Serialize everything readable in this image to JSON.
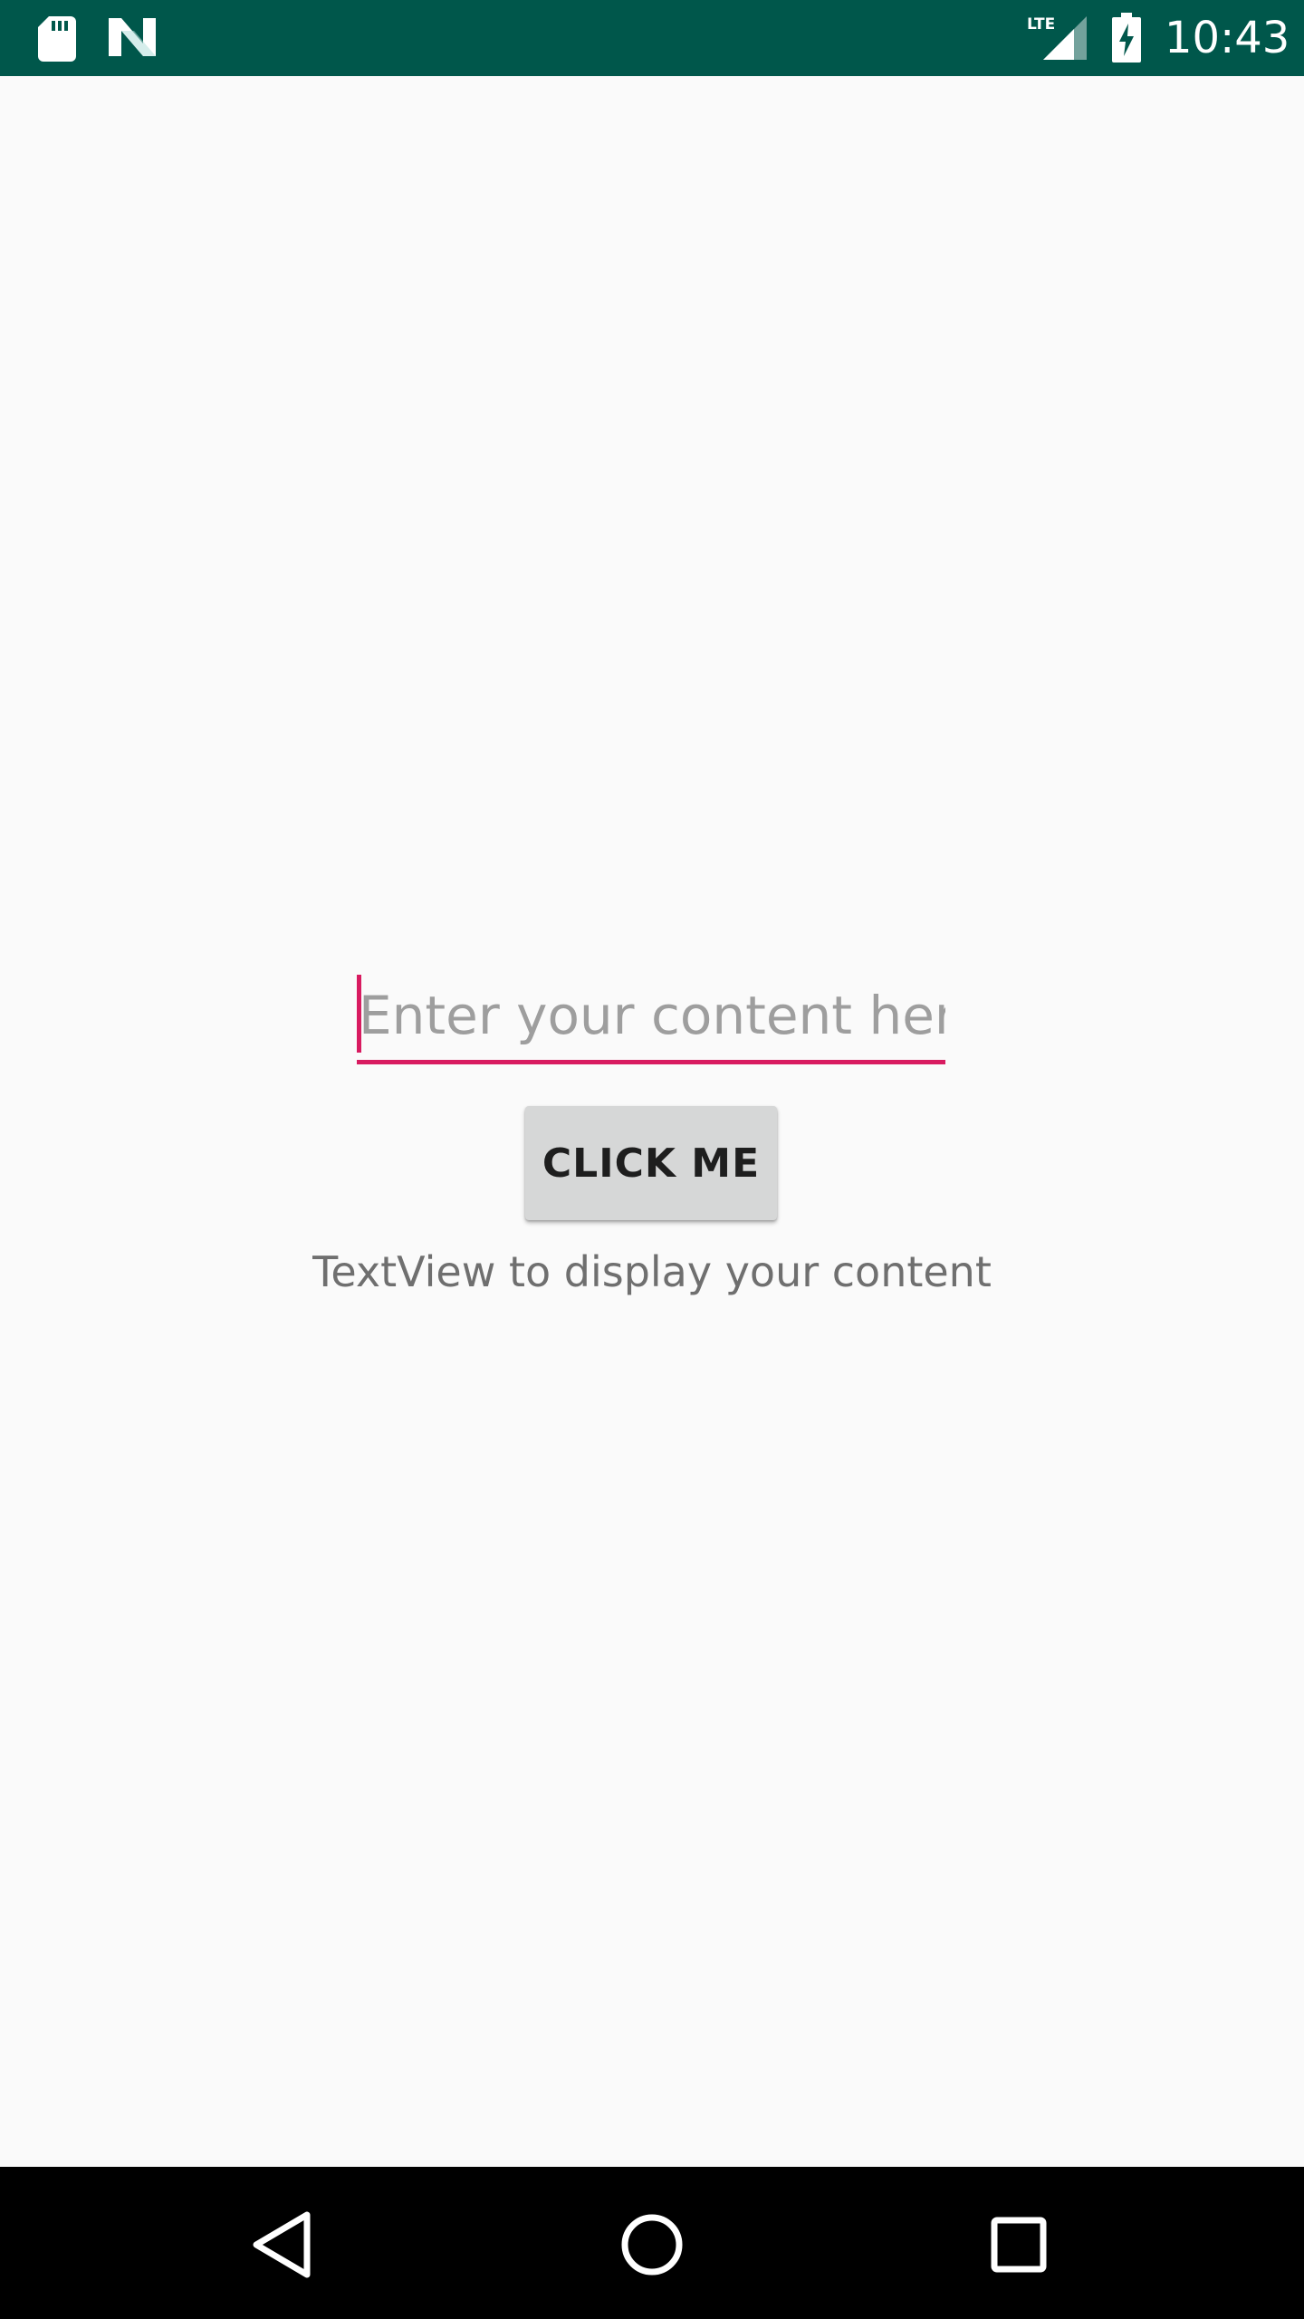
{
  "status_bar": {
    "time": "10:43",
    "network_label": "LTE",
    "background_color": "#00574b",
    "icons": [
      "sd-card-icon",
      "n-icon",
      "lte-signal-icon",
      "battery-charging-icon"
    ]
  },
  "main": {
    "input": {
      "value": "",
      "placeholder": "Enter your content here",
      "accent_color": "#d81b60"
    },
    "button": {
      "label": "CLICK ME"
    },
    "text_view": {
      "text": "TextView to display your content"
    }
  },
  "nav_bar": {
    "icons": [
      "back-icon",
      "home-icon",
      "recents-icon"
    ]
  }
}
